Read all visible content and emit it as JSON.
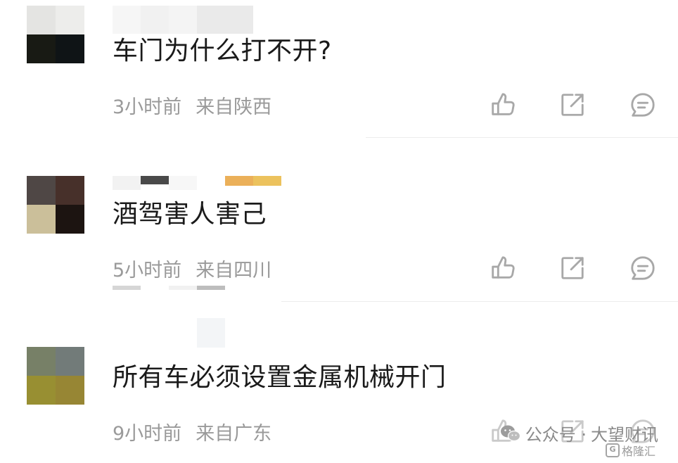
{
  "comments": [
    {
      "text": "车门为什么打不开?",
      "time": "3小时前",
      "location": "来自陕西",
      "avatar_colors": [
        "#e4e4e2",
        "#ededeb",
        "#181a14",
        "#0f1416"
      ]
    },
    {
      "text": "酒驾害人害己",
      "time": "5小时前",
      "location": "来自四川",
      "avatar_colors": [
        "#4f4745",
        "#47302a",
        "#cbbf9a",
        "#1c1411"
      ]
    },
    {
      "text": "所有车必须设置金属机械开门",
      "time": "9小时前",
      "location": "来自广东",
      "avatar_colors": [
        "#778067",
        "#727b79",
        "#988f32",
        "#978634"
      ]
    }
  ],
  "icons": {
    "like": "thumbs-up-icon",
    "share": "share-icon",
    "reply": "comment-icon"
  },
  "watermark": {
    "prefix": "公众号 · ",
    "name": "大望财讯",
    "badge": "格隆汇"
  },
  "colors": {
    "text": "#1a1a1a",
    "meta": "#9a9a9a",
    "icon": "#a8a8a8"
  }
}
